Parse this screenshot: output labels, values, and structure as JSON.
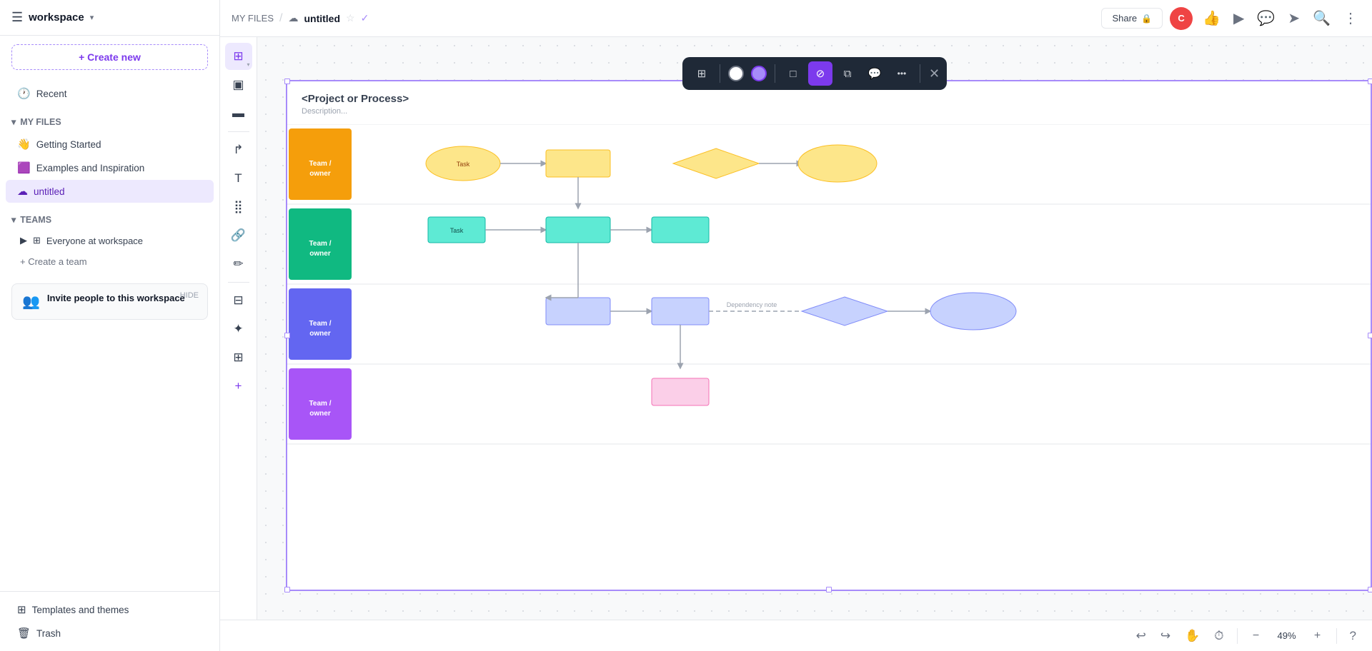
{
  "app": {
    "workspace_name": "workspace",
    "workspace_chevron": "▾"
  },
  "sidebar": {
    "create_new_label": "+ Create new",
    "recent_label": "Recent",
    "my_files_label": "MY FILES",
    "files": [
      {
        "id": "getting-started",
        "icon": "👋",
        "name": "Getting Started"
      },
      {
        "id": "examples",
        "icon": "🟪",
        "name": "Examples and Inspiration"
      },
      {
        "id": "untitled",
        "icon": "☁",
        "name": "untitled",
        "active": true
      }
    ],
    "teams_label": "TEAMS",
    "team_items": [
      {
        "id": "everyone",
        "icon": "⊞",
        "name": "Everyone at workspace"
      }
    ],
    "create_team_label": "+ Create a team",
    "invite_title": "Invite people to this workspace",
    "invite_sub": "",
    "hide_label": "HIDE",
    "templates_label": "Templates and themes",
    "trash_label": "Trash"
  },
  "topbar": {
    "breadcrumb": "MY FILES",
    "separator": "/",
    "file_name": "untitled",
    "share_label": "Share",
    "lock_icon": "🔒",
    "user_initials": "C"
  },
  "toolbar": {
    "tools": [
      {
        "id": "select",
        "icon": "⊞",
        "active": true
      },
      {
        "id": "frame",
        "icon": "⤡"
      },
      {
        "id": "template",
        "icon": "▣"
      },
      {
        "id": "text-basic",
        "icon": "▬"
      },
      {
        "id": "shape-bar",
        "icon": "▭"
      },
      {
        "id": "curve",
        "icon": "↱"
      },
      {
        "id": "text",
        "icon": "T"
      },
      {
        "id": "grid",
        "icon": "⣿"
      },
      {
        "id": "link",
        "icon": "🔗"
      },
      {
        "id": "pencil",
        "icon": "✏"
      },
      {
        "id": "table",
        "icon": "⊟"
      },
      {
        "id": "sparkle",
        "icon": "✦"
      },
      {
        "id": "layout",
        "icon": "⊞"
      },
      {
        "id": "plus",
        "icon": "+"
      }
    ]
  },
  "selection_toolbar": {
    "buttons": [
      {
        "id": "sel-frames",
        "icon": "⊞",
        "active": false
      },
      {
        "id": "col-white",
        "type": "color",
        "color": "#ffffff"
      },
      {
        "id": "col-purple",
        "type": "color",
        "color": "#a78bfa",
        "active": true
      },
      {
        "id": "rect",
        "icon": "□",
        "active": false
      },
      {
        "id": "strikethrough",
        "icon": "⊘",
        "active": false
      },
      {
        "id": "duplicate",
        "icon": "⧉",
        "active": false
      },
      {
        "id": "comment",
        "icon": "💬",
        "active": false
      },
      {
        "id": "more",
        "icon": "···",
        "active": false
      }
    ],
    "close_icon": "✕"
  },
  "diagram": {
    "title": "<Project or Process>",
    "subtitle": "Description...",
    "swimlanes": [
      {
        "id": "lane1",
        "label": "Team / owner",
        "color": "#f59e0b"
      },
      {
        "id": "lane2",
        "label": "Team / owner",
        "color": "#10b981"
      },
      {
        "id": "lane3",
        "label": "Team / owner",
        "color": "#6366f1"
      },
      {
        "id": "lane4",
        "label": "Team / owner",
        "color": "#a855f7"
      }
    ]
  },
  "bottom_bar": {
    "undo_icon": "↩",
    "redo_icon": "↪",
    "pan_icon": "✋",
    "history_icon": "⏱",
    "zoom_out_icon": "−",
    "zoom_level": "49%",
    "zoom_in_icon": "+",
    "help_icon": "?"
  }
}
